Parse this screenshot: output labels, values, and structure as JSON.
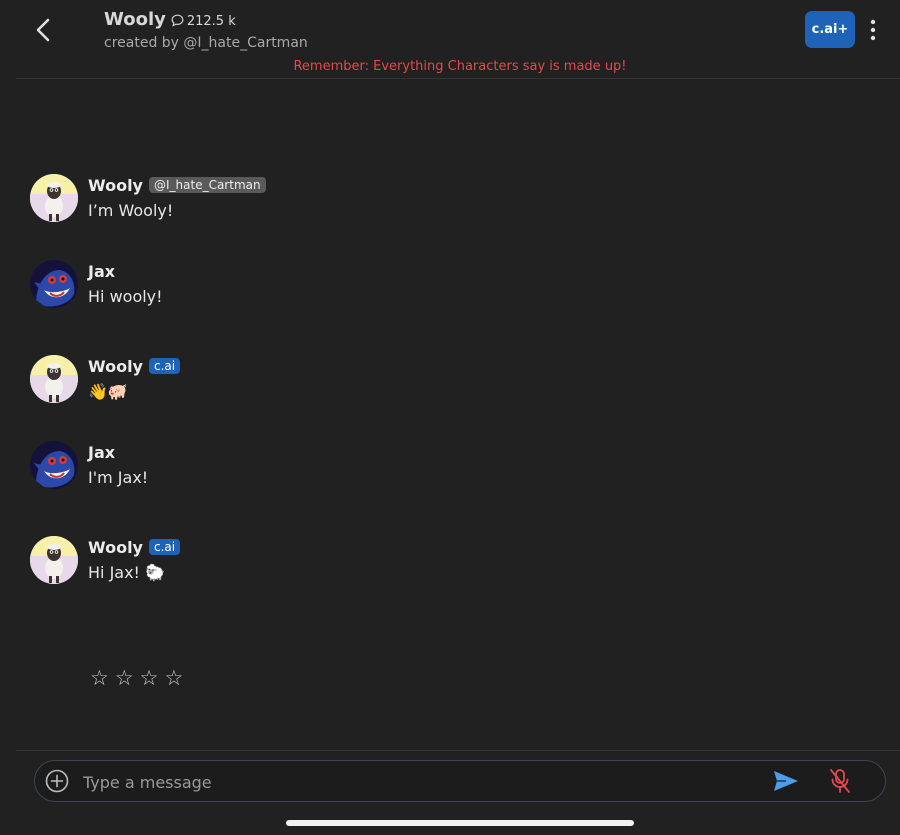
{
  "header": {
    "title": "Wooly",
    "interactions": "212.5 k",
    "creator": "created by @I_hate_Cartman",
    "plus_label": "c.ai+",
    "disclaimer": "Remember: Everything Characters say is made up!"
  },
  "messages": [
    {
      "name": "Wooly",
      "tag": "@I_hate_Cartman",
      "text": "I’m Wooly!"
    },
    {
      "name": "Jax",
      "text": "Hi wooly!"
    },
    {
      "name": "Wooly",
      "tag": "c.ai",
      "text": "👋🐖"
    },
    {
      "name": "Jax",
      "text": "I'm Jax!"
    },
    {
      "name": "Wooly",
      "tag": "c.ai",
      "text": "Hi Jax! 🐑"
    }
  ],
  "rating": {
    "stars": [
      "☆",
      "☆",
      "☆",
      "☆"
    ]
  },
  "composer": {
    "placeholder": "Type a message"
  },
  "colors": {
    "background": "#212121",
    "accent": "#1e63b8",
    "disclaimer": "#e5484d",
    "send": "#4a9fe8",
    "mic_muted": "#e5484d"
  },
  "icons": {
    "back": "chevron-left-icon",
    "interactions": "chat-bubble-icon",
    "more": "more-vertical-icon",
    "add": "plus-circle-icon",
    "send": "send-icon",
    "mic": "mic-off-icon"
  }
}
